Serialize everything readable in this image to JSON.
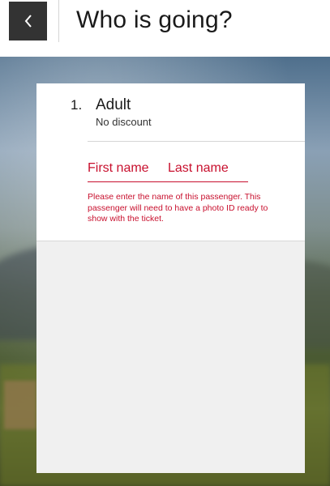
{
  "header": {
    "title": "Who is going?",
    "back_icon": "chevron-left-icon"
  },
  "passenger": {
    "index": "1.",
    "type": "Adult",
    "discount": "No discount",
    "first_name_placeholder": "First name",
    "last_name_placeholder": "Last name",
    "error_message": "Please enter the name of this passenger. This passenger will need to have a photo ID ready to show with the ticket."
  },
  "colors": {
    "accent_error": "#c8102e",
    "back_button_bg": "#333333",
    "card_bg": "#ffffff",
    "card_lower_bg": "#f0f0f0"
  }
}
